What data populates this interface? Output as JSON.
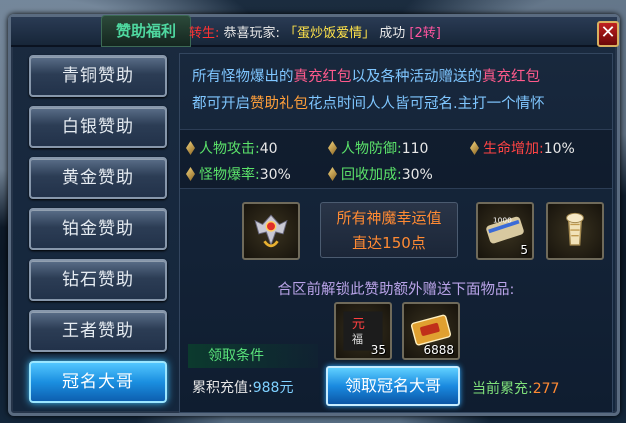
{
  "title_tab": "赞助福利",
  "marquee": {
    "prefix": "转生:",
    "text1": "恭喜玩家:",
    "player": "「蛋炒饭爱情」",
    "text2": "成功",
    "tier": "[2转]"
  },
  "close_label": "✕",
  "menu": [
    {
      "label": "青铜赞助",
      "active": false
    },
    {
      "label": "白银赞助",
      "active": false
    },
    {
      "label": "黄金赞助",
      "active": false
    },
    {
      "label": "铂金赞助",
      "active": false
    },
    {
      "label": "钻石赞助",
      "active": false
    },
    {
      "label": "王者赞助",
      "active": false
    },
    {
      "label": "冠名大哥",
      "active": true
    }
  ],
  "intro": {
    "l1_a": "所有怪物爆出的",
    "l1_b": "真充红包",
    "l1_c": "以及各种活动赠送的",
    "l1_d": "真充红包",
    "l2_a": "都可开启",
    "l2_b": "赞助礼包",
    "l2_c": "花点时间人人皆可冠名.主打一个情怀"
  },
  "attrs": [
    {
      "label": "人物攻击:",
      "value": "40",
      "color": "green"
    },
    {
      "label": "人物防御:",
      "value": "110",
      "color": "green"
    },
    {
      "label": "生命增加:",
      "value": "10%",
      "color": "red"
    },
    {
      "label": "怪物爆率:",
      "value": "30%",
      "color": "green"
    },
    {
      "label": "回收加成:",
      "value": "30%",
      "color": "green"
    }
  ],
  "luck_box": {
    "line1": "所有神魔幸运值",
    "line2": "直达150点"
  },
  "reward_items": [
    {
      "icon": "wings-icon",
      "count": ""
    },
    {
      "icon": "scroll-icon",
      "count": "5"
    },
    {
      "icon": "bone-icon",
      "count": ""
    }
  ],
  "unlock_title": "合区前解锁此赞助额外赠送下面物品:",
  "bonus_items": [
    {
      "icon": "yuan-token-icon",
      "count": "35"
    },
    {
      "icon": "ticket-icon",
      "count": "6888"
    }
  ],
  "condition_title": "领取条件",
  "cumulative": {
    "label": "累积充值:",
    "value": "988元"
  },
  "claim_button": "领取冠名大哥",
  "current": {
    "label": "当前累充:",
    "value": "277"
  },
  "colors": {
    "accent_blue": "#1b8fe0",
    "green": "#5be36a",
    "red": "#ff4444",
    "orange": "#ff8a33",
    "pink": "#ff5a8c"
  }
}
